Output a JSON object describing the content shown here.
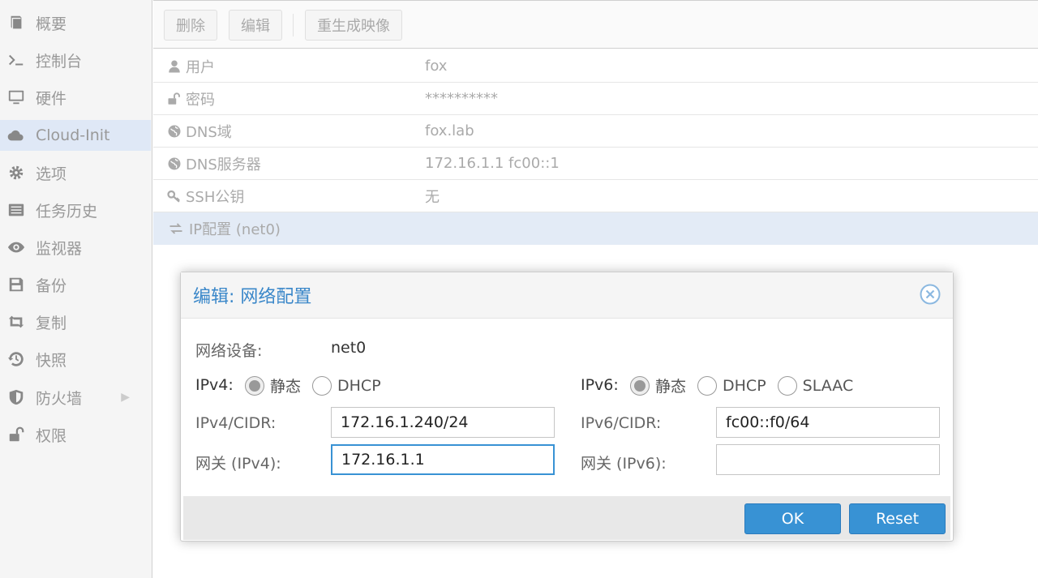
{
  "sidebar": {
    "items": [
      {
        "label": "概要",
        "icon": "book-icon"
      },
      {
        "label": "控制台",
        "icon": "terminal-icon"
      },
      {
        "label": "硬件",
        "icon": "monitor-icon"
      },
      {
        "label": "Cloud-Init",
        "icon": "cloud-icon",
        "active": true
      },
      {
        "label": "选项",
        "icon": "gear-icon"
      },
      {
        "label": "任务历史",
        "icon": "list-icon"
      },
      {
        "label": "监视器",
        "icon": "eye-icon"
      },
      {
        "label": "备份",
        "icon": "floppy-icon"
      },
      {
        "label": "复制",
        "icon": "retweet-icon"
      },
      {
        "label": "快照",
        "icon": "history-icon"
      },
      {
        "label": "防火墙",
        "icon": "shield-icon"
      },
      {
        "label": "权限",
        "icon": "unlock-icon"
      }
    ]
  },
  "toolbar": {
    "delete_label": "删除",
    "edit_label": "编辑",
    "regenerate_label": "重生成映像"
  },
  "rows": [
    {
      "key": "用户",
      "value": "fox",
      "icon": "user-icon"
    },
    {
      "key": "密码",
      "value": "**********",
      "icon": "unlock-icon"
    },
    {
      "key": "DNS域",
      "value": "fox.lab",
      "icon": "globe-icon"
    },
    {
      "key": "DNS服务器",
      "value": "172.16.1.1 fc00::1",
      "icon": "globe-icon"
    },
    {
      "key": "SSH公钥",
      "value": "无",
      "icon": "key-icon"
    },
    {
      "key": "IP配置 (net0)",
      "value": "",
      "icon": "exchange-icon",
      "selected": true
    }
  ],
  "dialog": {
    "title": "编辑: 网络配置",
    "net_device_label": "网络设备:",
    "net_device_value": "net0",
    "ipv4_label": "IPv4:",
    "ipv4_static": "静态",
    "ipv4_dhcp": "DHCP",
    "ipv6_label": "IPv6:",
    "ipv6_static": "静态",
    "ipv6_dhcp": "DHCP",
    "ipv6_slaac": "SLAAC",
    "ipv4_cidr_label": "IPv4/CIDR:",
    "ipv4_cidr_value": "172.16.1.240/24",
    "ipv6_cidr_label": "IPv6/CIDR:",
    "ipv6_cidr_value": "fc00::f0/64",
    "gw4_label": "网关 (IPv4):",
    "gw4_value": "172.16.1.1",
    "gw6_label": "网关 (IPv6):",
    "gw6_value": "",
    "ok_label": "OK",
    "reset_label": "Reset"
  },
  "colors": {
    "accent": "#3892d4",
    "title": "#3a87c9",
    "selected_row": "#e3ebf6"
  }
}
